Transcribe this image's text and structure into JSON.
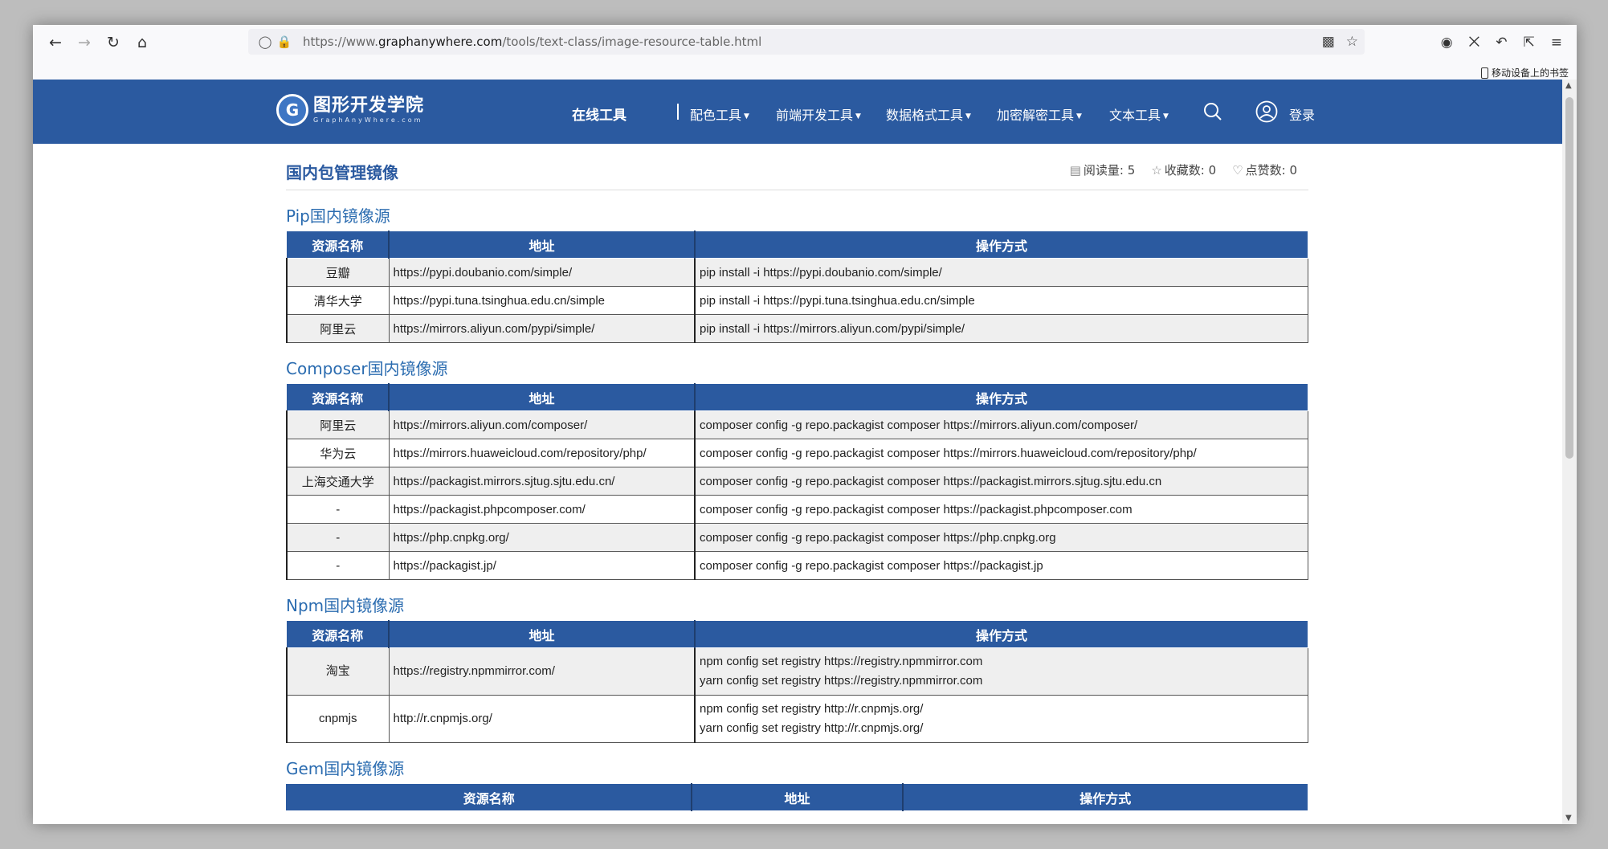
{
  "browser": {
    "url_prefix": "https://www.",
    "url_host": "graphanywhere.com",
    "url_path": "/tools/text-class/image-resource-table.html",
    "bookmark_label": "移动设备上的书签"
  },
  "site": {
    "logo_mark": "G",
    "logo_name": "图形开发学院",
    "logo_sub": "GraphAnyWhere.com",
    "menu_main": "在线工具",
    "menu_items": [
      "配色工具",
      "前端开发工具",
      "数据格式工具",
      "加密解密工具",
      "文本工具"
    ],
    "login": "登录"
  },
  "page": {
    "title": "国内包管理镜像",
    "stats": {
      "reads_label": "阅读量:",
      "reads": "5",
      "favs_label": "收藏数:",
      "favs": "0",
      "likes_label": "点赞数:",
      "likes": "0"
    }
  },
  "headers": {
    "name": "资源名称",
    "addr": "地址",
    "cmd": "操作方式"
  },
  "sections": [
    {
      "title": "Pip国内镜像源",
      "rows": [
        {
          "name": "豆瓣",
          "addr": "https://pypi.doubanio.com/simple/",
          "cmd": [
            "pip install -i https://pypi.doubanio.com/simple/"
          ]
        },
        {
          "name": "清华大学",
          "addr": "https://pypi.tuna.tsinghua.edu.cn/simple",
          "cmd": [
            "pip install -i https://pypi.tuna.tsinghua.edu.cn/simple"
          ]
        },
        {
          "name": "阿里云",
          "addr": "https://mirrors.aliyun.com/pypi/simple/",
          "cmd": [
            "pip install -i https://mirrors.aliyun.com/pypi/simple/"
          ]
        }
      ]
    },
    {
      "title": "Composer国内镜像源",
      "rows": [
        {
          "name": "阿里云",
          "addr": "https://mirrors.aliyun.com/composer/",
          "cmd": [
            "composer config -g repo.packagist composer https://mirrors.aliyun.com/composer/"
          ]
        },
        {
          "name": "华为云",
          "addr": "https://mirrors.huaweicloud.com/repository/php/",
          "cmd": [
            "composer config -g repo.packagist composer https://mirrors.huaweicloud.com/repository/php/"
          ]
        },
        {
          "name": "上海交通大学",
          "addr": "https://packagist.mirrors.sjtug.sjtu.edu.cn/",
          "cmd": [
            "composer config -g repo.packagist composer https://packagist.mirrors.sjtug.sjtu.edu.cn"
          ]
        },
        {
          "name": "-",
          "addr": "https://packagist.phpcomposer.com/",
          "cmd": [
            "composer config -g repo.packagist composer https://packagist.phpcomposer.com"
          ]
        },
        {
          "name": "-",
          "addr": "https://php.cnpkg.org/",
          "cmd": [
            "composer config -g repo.packagist composer https://php.cnpkg.org"
          ]
        },
        {
          "name": "-",
          "addr": "https://packagist.jp/",
          "cmd": [
            "composer config -g repo.packagist composer https://packagist.jp"
          ]
        }
      ]
    },
    {
      "title": "Npm国内镜像源",
      "rows": [
        {
          "name": "淘宝",
          "addr": "https://registry.npmmirror.com/",
          "cmd": [
            "npm config set registry https://registry.npmmirror.com",
            "yarn config set registry https://registry.npmmirror.com"
          ]
        },
        {
          "name": "cnpmjs",
          "addr": "http://r.cnpmjs.org/",
          "cmd": [
            "npm config set registry http://r.cnpmjs.org/",
            "yarn config set registry http://r.cnpmjs.org/"
          ]
        }
      ]
    },
    {
      "title": "Gem国内镜像源",
      "rows": []
    }
  ],
  "colors": {
    "brand": "#2b5aa0",
    "link": "#2b6cb0"
  }
}
